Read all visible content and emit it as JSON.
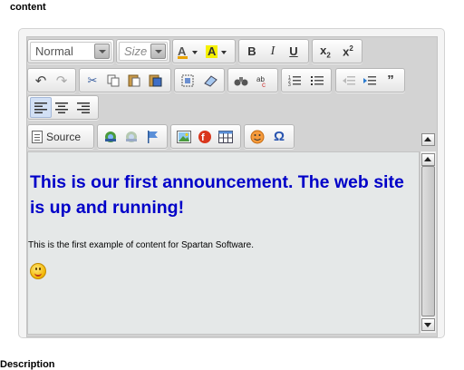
{
  "field_label": "content",
  "toolbar": {
    "format_combo": "Normal",
    "size_combo": "Size",
    "source_label": "Source"
  },
  "content": {
    "heading": "This is our first announcement. The web site is up and running!",
    "paragraph": "This is the first example of content for Spartan Software."
  },
  "colors": {
    "heading": "#0000c8",
    "content_bg": "#e5e8e8",
    "toolbar_bg": "#d3d3d3"
  },
  "bottom_label": "Description"
}
